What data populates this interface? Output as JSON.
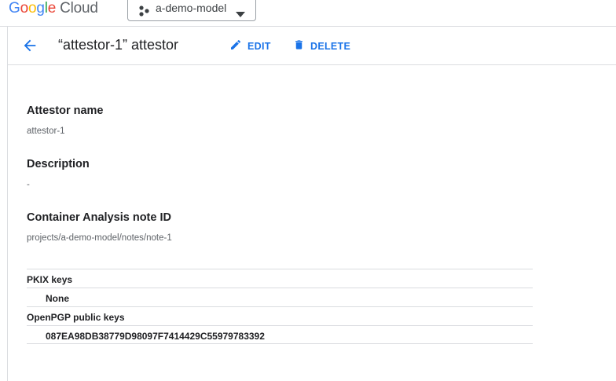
{
  "app": {
    "logo_google": [
      "G",
      "o",
      "o",
      "g",
      "l",
      "e"
    ],
    "logo_cloud": "Cloud",
    "project_name": "a-demo-model"
  },
  "header": {
    "title": "“attestor-1” attestor",
    "edit_label": "EDIT",
    "delete_label": "DELETE"
  },
  "details": [
    {
      "label": "Attestor name",
      "value": "attestor-1"
    },
    {
      "label": "Description",
      "value": "-"
    },
    {
      "label": "Container Analysis note ID",
      "value": "projects/a-demo-model/notes/note-1"
    }
  ],
  "keys": {
    "pkix_label": "PKIX keys",
    "pkix_value": "None",
    "pgp_label": "OpenPGP public keys",
    "pgp_value": "087EA98DB38779D98097F7414429C55979783392"
  },
  "colors": {
    "accent": "#1a73e8",
    "text": "#202124",
    "secondary_text": "#5f6368",
    "divider": "#dadce0"
  },
  "icons": [
    "arrow-back-icon",
    "pencil-icon",
    "trash-icon",
    "project-dots-icon",
    "caret-down-icon"
  ]
}
